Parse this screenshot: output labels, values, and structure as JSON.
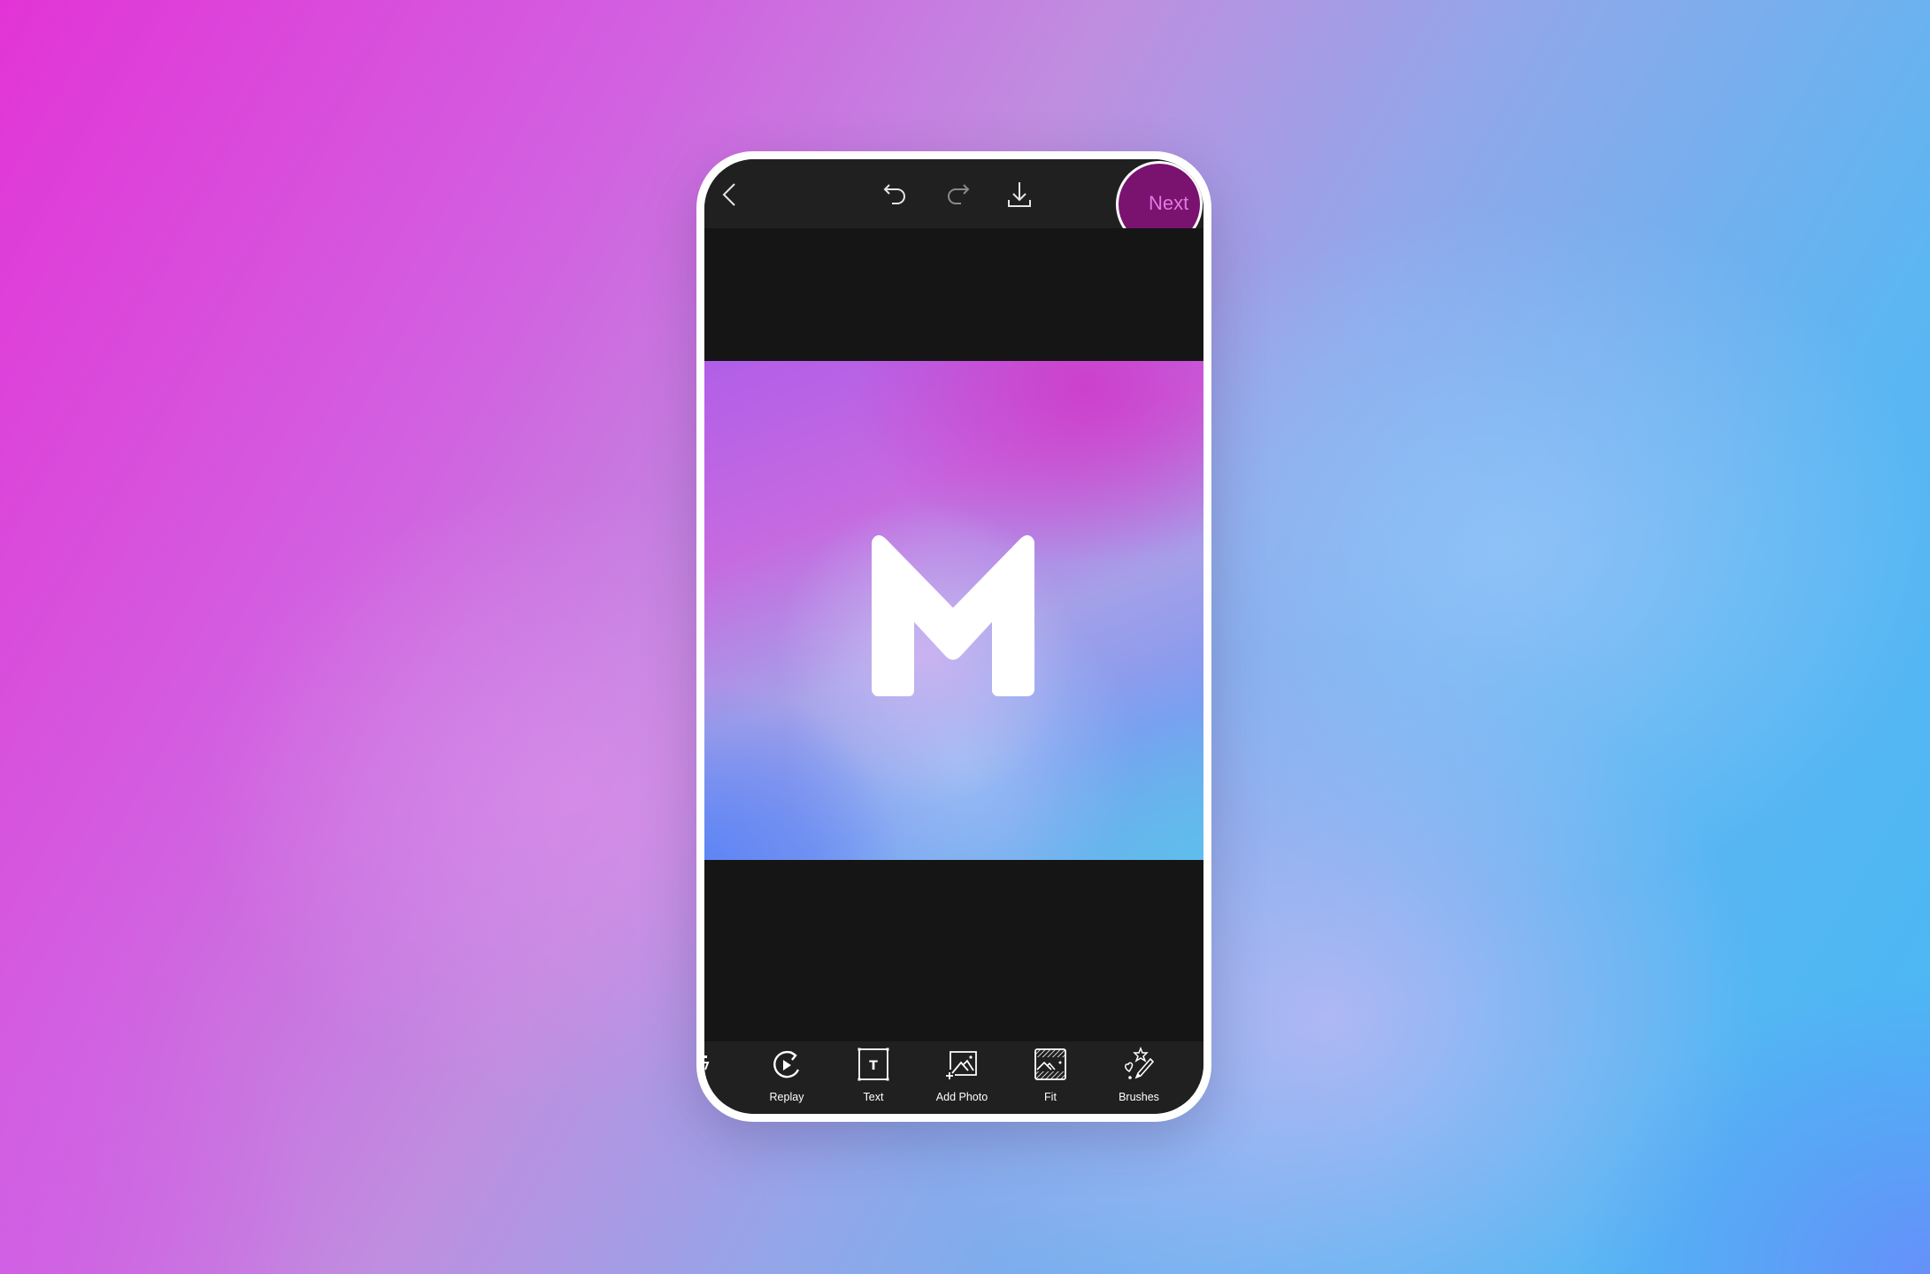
{
  "header": {
    "back_icon": "chevron-left-icon",
    "undo_icon": "undo-icon",
    "redo_icon": "redo-icon",
    "download_icon": "download-icon",
    "next_label": "Next"
  },
  "artwork": {
    "logo_letter": "M",
    "logo_color": "#ffffff"
  },
  "toolbar": {
    "items": [
      {
        "label": "Replay",
        "icon": "replay-icon"
      },
      {
        "label": "Text",
        "icon": "text-icon"
      },
      {
        "label": "Add Photo",
        "icon": "add-photo-icon"
      },
      {
        "label": "Fit",
        "icon": "fit-icon"
      },
      {
        "label": "Brushes",
        "icon": "brushes-icon"
      }
    ]
  },
  "colors": {
    "next_button": "#7a1270",
    "next_text": "#e07ae0",
    "header_bg": "#202020",
    "canvas_bg": "#151515"
  }
}
